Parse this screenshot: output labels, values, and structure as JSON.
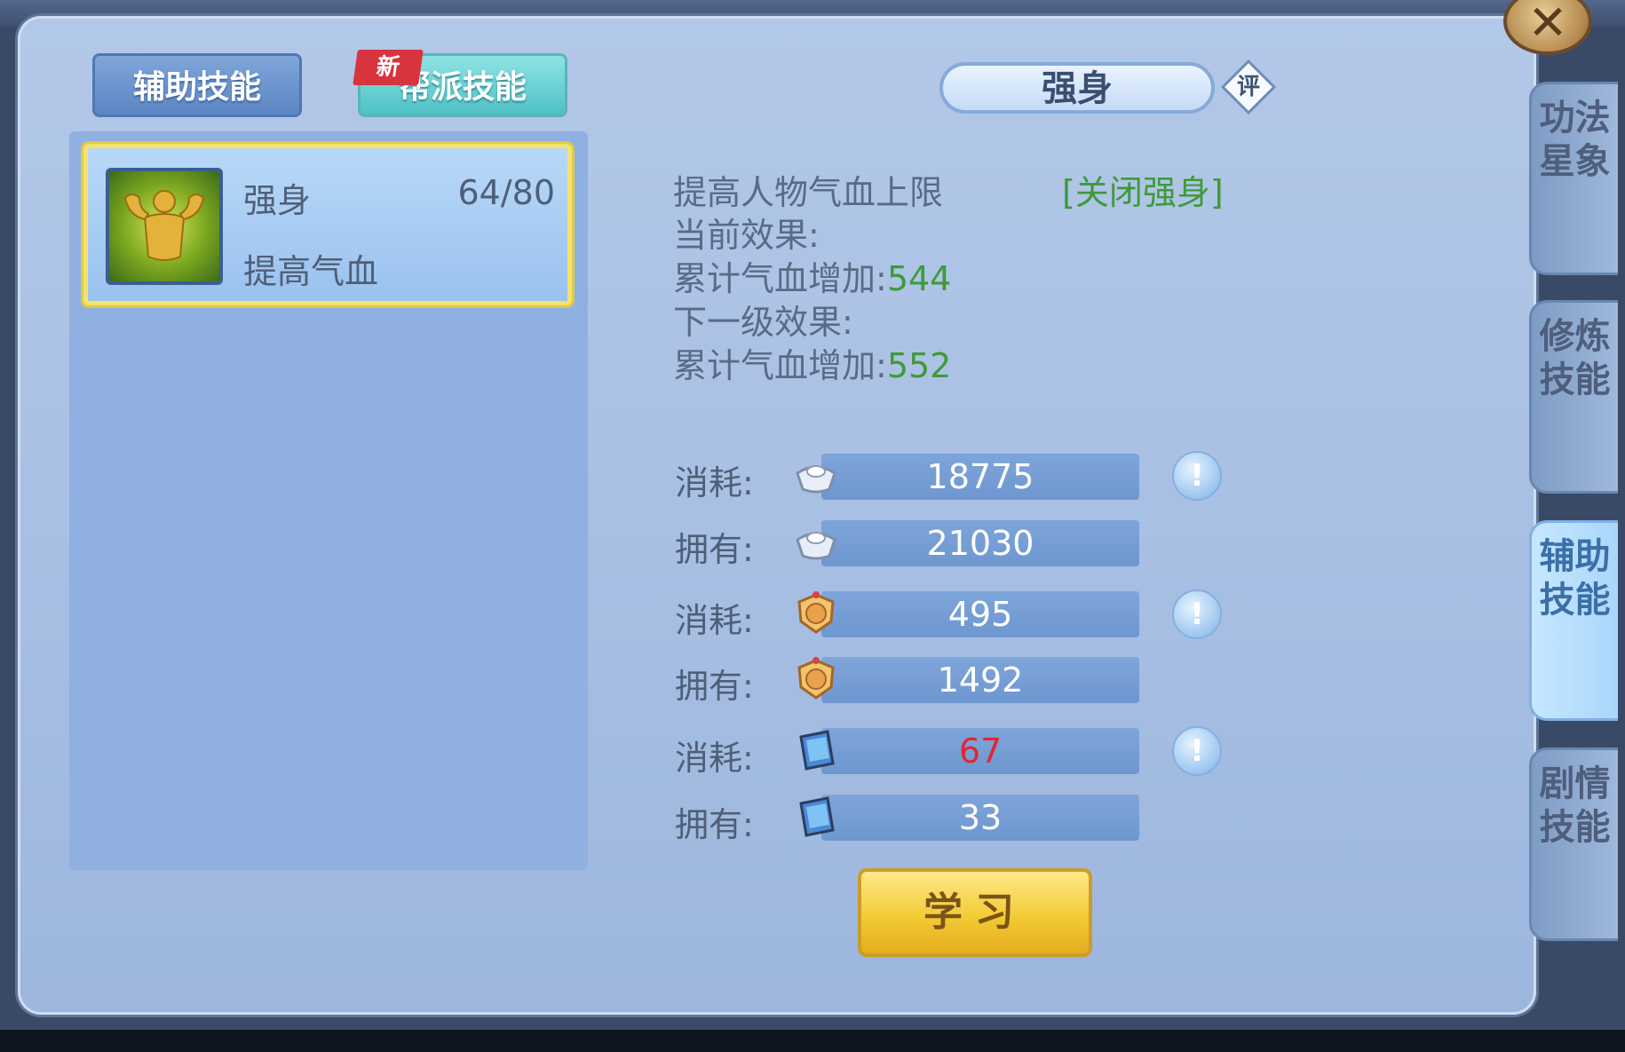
{
  "header": {
    "close_label": "✕"
  },
  "tabs": {
    "aux_label": "辅助技能",
    "sect_label": "帮派技能",
    "new_badge": "新"
  },
  "skill_list": [
    {
      "name": "强身",
      "level": "64/80",
      "desc": "提高气血"
    }
  ],
  "detail": {
    "title": "强身",
    "rate_badge": "评",
    "description": "提高人物气血上限",
    "toggle_link": "[关闭强身]",
    "current_label": "当前效果:",
    "current_stat_label": "累计气血增加:",
    "current_stat_value": "544",
    "next_label": "下一级效果:",
    "next_stat_label": "累计气血增加:",
    "next_stat_value": "552"
  },
  "resources": [
    {
      "label": "消耗:",
      "value": "18775",
      "icon": "silver-ingot-icon",
      "info": "!"
    },
    {
      "label": "拥有:",
      "value": "21030",
      "icon": "silver-ingot-icon"
    },
    {
      "label": "消耗:",
      "value": "495",
      "icon": "contribution-medal-icon",
      "info": "!"
    },
    {
      "label": "拥有:",
      "value": "1492",
      "icon": "contribution-medal-icon"
    },
    {
      "label": "消耗:",
      "value": "67",
      "icon": "skill-book-icon",
      "info": "!",
      "insufficient": true
    },
    {
      "label": "拥有:",
      "value": "33",
      "icon": "skill-book-icon"
    }
  ],
  "learn_button": "学习",
  "side_tabs": [
    {
      "label": "功法星象"
    },
    {
      "label": "修炼技能"
    },
    {
      "label": "辅助技能",
      "active": true
    },
    {
      "label": "剧情技能"
    }
  ],
  "colors": {
    "panel": "#a7bfe3",
    "accent_green": "#3f9a3a",
    "insufficient_red": "#e3262e",
    "button_gold": "#f3cb35"
  }
}
